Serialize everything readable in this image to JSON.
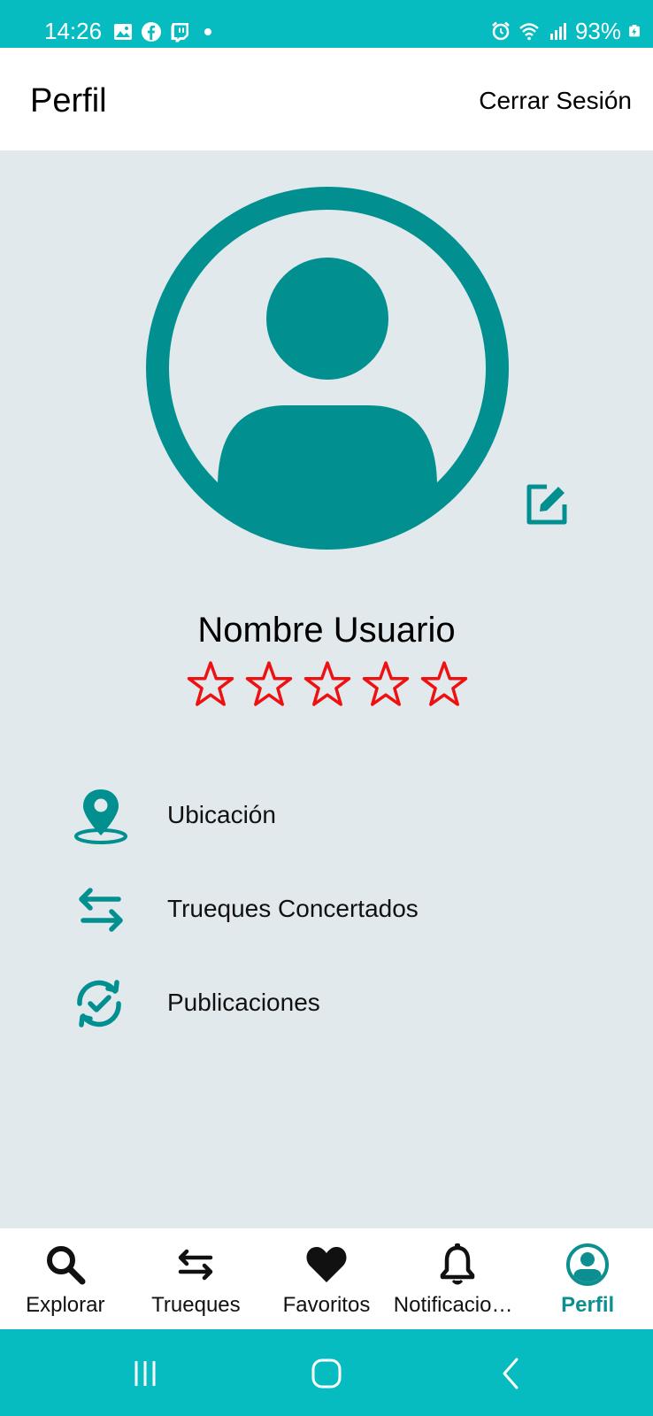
{
  "status_bar": {
    "time": "14:26",
    "battery": "93%",
    "background": "#06bcc0",
    "notification_icons": [
      "gallery-icon",
      "facebook-icon",
      "twitch-icon",
      "dot-icon"
    ],
    "system_icons": [
      "alarm-icon",
      "wifi-icon",
      "signal-icon",
      "battery-icon"
    ]
  },
  "app_bar": {
    "title": "Perfil",
    "logout_label": "Cerrar Sesión"
  },
  "profile": {
    "name": "Nombre Usuario",
    "rating": 0,
    "rating_max": 5,
    "accent_color": "#018f8f",
    "star_color": "#ee1111",
    "avatar_icon": "user-avatar-icon",
    "edit_icon": "edit-icon"
  },
  "menu": {
    "items": [
      {
        "label": "Ubicación",
        "icon": "location-pin-icon"
      },
      {
        "label": "Trueques Concertados",
        "icon": "swap-arrows-icon"
      },
      {
        "label": "Publicaciones",
        "icon": "sync-check-icon"
      }
    ]
  },
  "bottom_nav": {
    "items": [
      {
        "label": "Explorar",
        "icon": "search-icon"
      },
      {
        "label": "Trueques",
        "icon": "swap-arrows-icon"
      },
      {
        "label": "Favoritos",
        "icon": "heart-icon"
      },
      {
        "label": "Notificaciones",
        "icon": "bell-icon"
      },
      {
        "label": "Perfil",
        "icon": "account-circle-icon"
      }
    ],
    "active": "Perfil",
    "active_color": "#0b8f90"
  },
  "system_nav": {
    "buttons": [
      "recent-apps-icon",
      "home-icon",
      "back-icon"
    ]
  }
}
